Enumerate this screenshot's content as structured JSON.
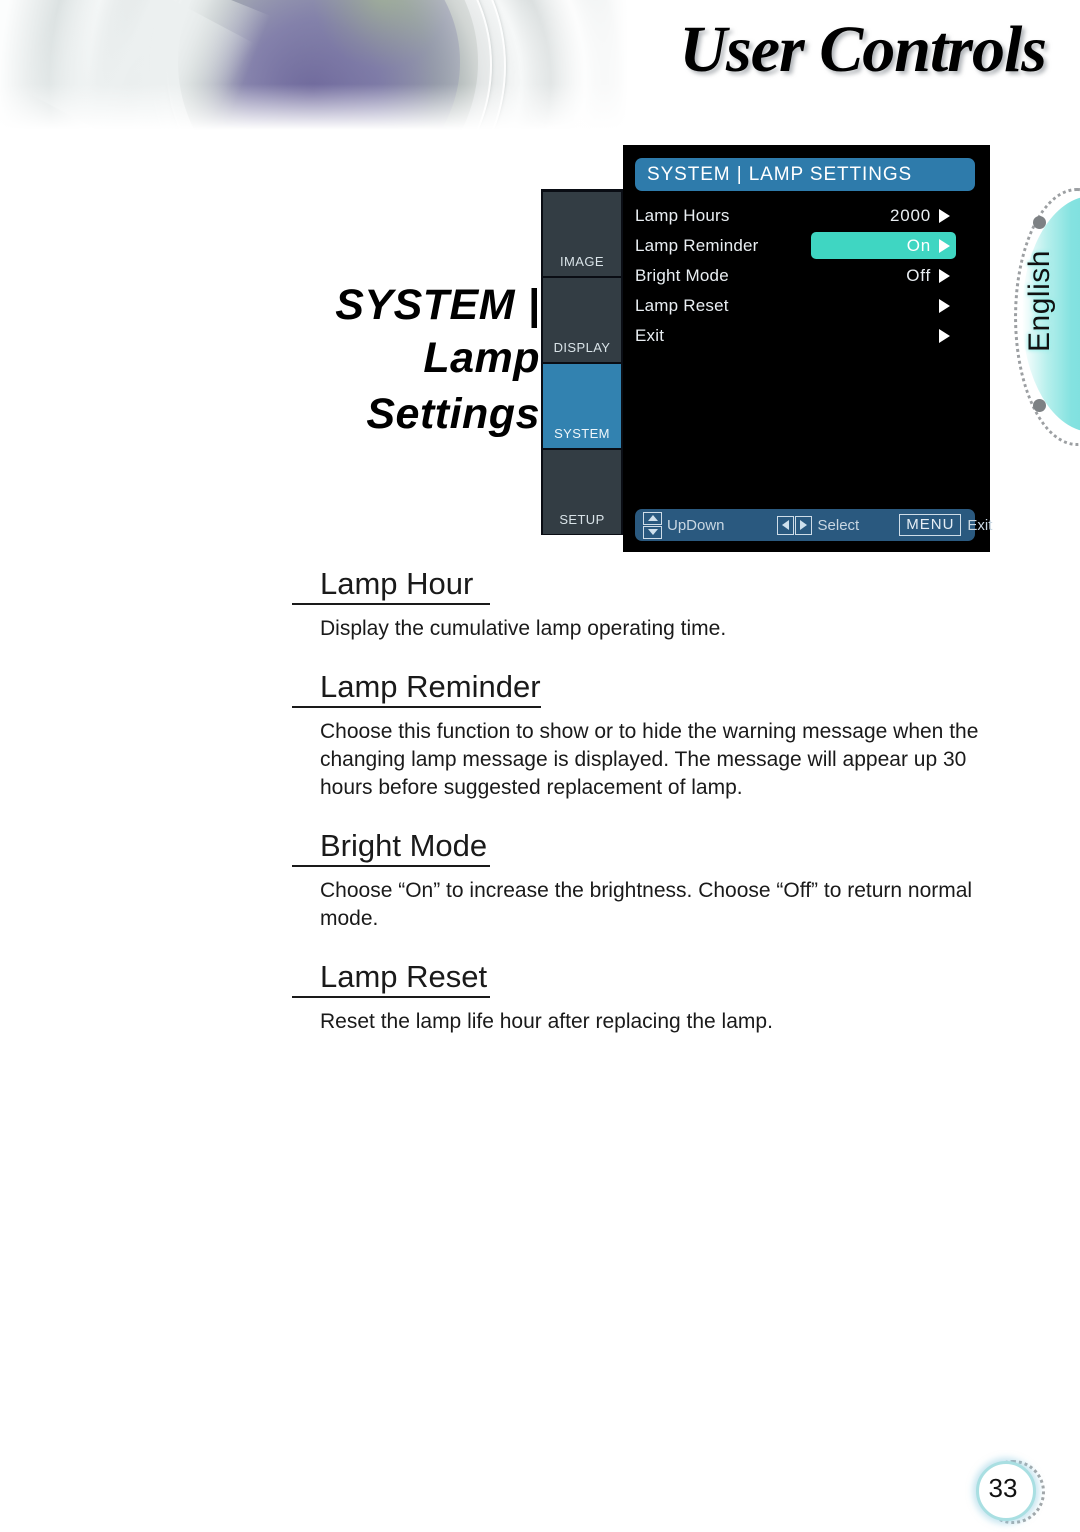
{
  "header": {
    "title": "User Controls"
  },
  "side_tab": {
    "language": "English"
  },
  "page_title": {
    "line1": "SYSTEM |",
    "line2": "Lamp Settings"
  },
  "osd": {
    "header_title": "SYSTEM | LAMP SETTINGS",
    "sidebar": [
      {
        "label": "IMAGE",
        "active": false
      },
      {
        "label": "DISPLAY",
        "active": false
      },
      {
        "label": "SYSTEM",
        "active": true
      },
      {
        "label": "SETUP",
        "active": false
      }
    ],
    "rows": [
      {
        "label": "Lamp Hours",
        "value": "2000",
        "highlighted": false,
        "arrow": "right-arrow-icon"
      },
      {
        "label": "Lamp Reminder",
        "value": "On",
        "highlighted": true,
        "arrow": "right-arrow-icon"
      },
      {
        "label": "Bright Mode",
        "value": "Off",
        "highlighted": false,
        "arrow": "right-arrow-icon"
      },
      {
        "label": "Lamp Reset",
        "value": "",
        "highlighted": false,
        "arrow": "right-arrow-icon"
      },
      {
        "label": "Exit",
        "value": "",
        "highlighted": false,
        "arrow": "right-arrow-icon"
      }
    ],
    "footer": {
      "updown_label": "UpDown",
      "select_label": "Select",
      "menu_key": "MENU",
      "exit_label": "Exit"
    },
    "colors": {
      "header_blue": "#2e7bab",
      "highlight_teal": "#3fd6c2",
      "sidebar_active_blue": "#3282b0",
      "sidebar_tab_gray": "#333d44",
      "panel_black": "#000000",
      "footer_blue": "#2a597f"
    }
  },
  "sections": [
    {
      "heading": "Lamp Hour",
      "body": "Display the cumulative lamp operating time."
    },
    {
      "heading": "Lamp Reminder",
      "body": "Choose this function to show or to hide the warning message when the changing lamp message is displayed. The message will appear up 30 hours before suggested replacement of lamp."
    },
    {
      "heading": "Bright Mode",
      "body": "Choose “On” to increase the brightness. Choose “Off” to return normal mode."
    },
    {
      "heading": "Lamp Reset",
      "body": "Reset the lamp life hour after replacing the lamp."
    }
  ],
  "page_number": "33"
}
